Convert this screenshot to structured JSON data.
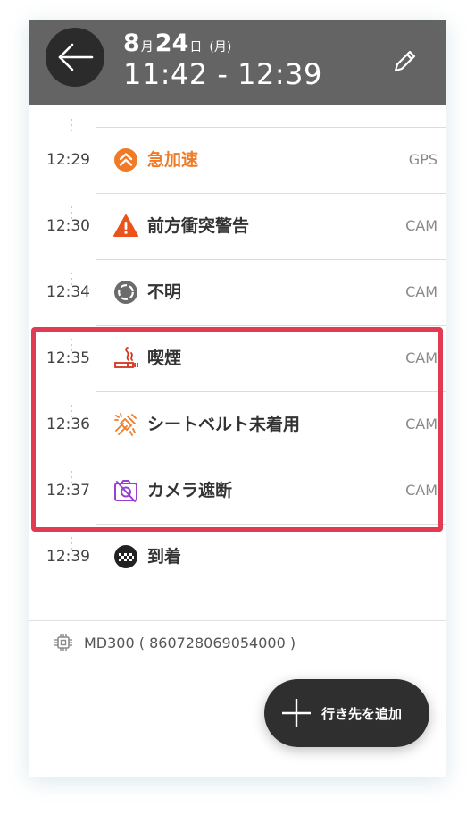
{
  "header": {
    "month": "8",
    "month_unit": "月",
    "day": "24",
    "day_unit": "日",
    "weekday": "(月)",
    "time_range": "11:42 - 12:39"
  },
  "events": [
    {
      "time": "12:29",
      "label": "急加速",
      "source": "GPS",
      "icon": "rapid-acceleration-icon"
    },
    {
      "time": "12:30",
      "label": "前方衝突警告",
      "source": "CAM",
      "icon": "warning-icon"
    },
    {
      "time": "12:34",
      "label": "不明",
      "source": "CAM",
      "icon": "unknown-icon"
    },
    {
      "time": "12:35",
      "label": "喫煙",
      "source": "CAM",
      "icon": "smoking-icon"
    },
    {
      "time": "12:36",
      "label": "シートベルト未着用",
      "source": "CAM",
      "icon": "seatbelt-icon"
    },
    {
      "time": "12:37",
      "label": "カメラ遮断",
      "source": "CAM",
      "icon": "camera-blocked-icon"
    },
    {
      "time": "12:39",
      "label": "到着",
      "source": "",
      "icon": "arrival-flag-icon"
    }
  ],
  "device": {
    "label": "MD300 ( 860728069054000 )",
    "icon": "chip-icon"
  },
  "fab": {
    "label": "行き先を追加",
    "icon": "plus-icon"
  },
  "colors": {
    "header_bg": "#646464",
    "highlight": "#e23a53",
    "orange": "#f07a25",
    "warning": "#e8541c",
    "smoking": "#d6321e",
    "purple": "#9a3fd0"
  }
}
